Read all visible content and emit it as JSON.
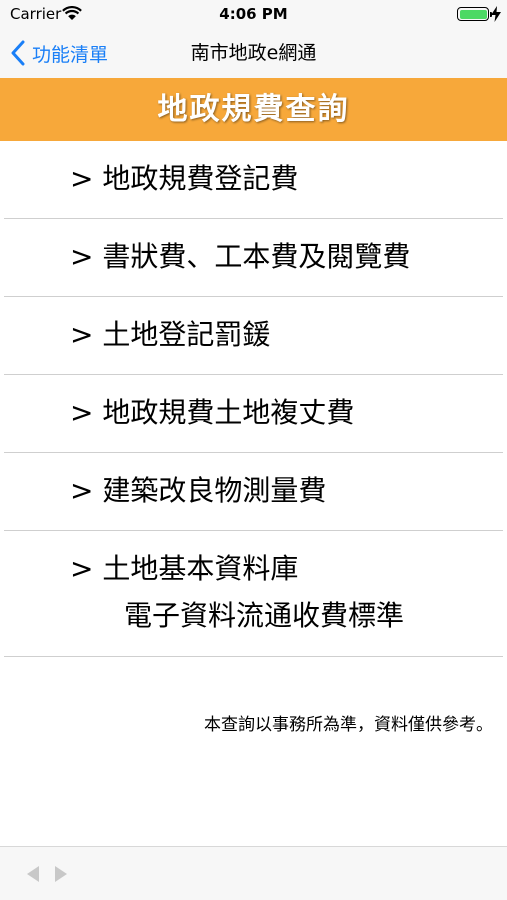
{
  "status_bar": {
    "carrier": "Carrier",
    "time": "4:06 PM",
    "battery_level": 1.0
  },
  "nav_bar": {
    "back_label": "功能清單",
    "title": "南市地政e網通"
  },
  "header": {
    "title": "地政規費查詢"
  },
  "menu": {
    "items": [
      {
        "label": "> 地政規費登記費"
      },
      {
        "label": "> 書狀費、工本費及閱覽費"
      },
      {
        "label": "> 土地登記罰鍰"
      },
      {
        "label": "> 地政規費土地複丈費"
      },
      {
        "label": "> 建築改良物測量費"
      },
      {
        "label": "> 土地基本資料庫",
        "label_line2": "電子資料流通收費標準"
      }
    ]
  },
  "disclaimer": "本查詢以事務所為準，資料僅供參考。",
  "colors": {
    "accent": "#1a7ff7",
    "header_bg": "#f7a83a",
    "battery": "#4cd964",
    "bar_bg": "#f7f7f7"
  },
  "toolbar": {
    "back_icon": "triangle-left-icon",
    "forward_icon": "triangle-right-icon"
  }
}
